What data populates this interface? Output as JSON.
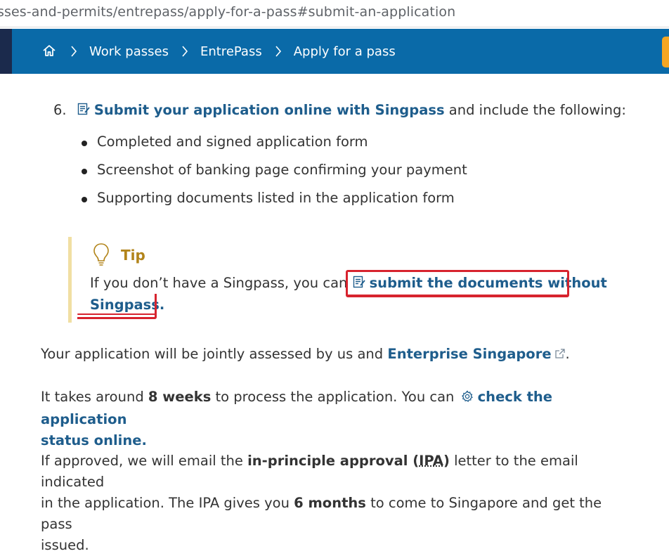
{
  "url": "sses-and-permits/entrepass/apply-for-a-pass#submit-an-application",
  "breadcrumb": {
    "items": [
      "Work passes",
      "EntrePass",
      "Apply for a pass"
    ]
  },
  "step": {
    "number": "6.",
    "link": "Submit your application online with Singpass",
    "rest": " and include the following:"
  },
  "bullets": [
    "Completed and signed application form",
    "Screenshot of banking page confirming your payment",
    "Supporting documents listed in the application form"
  ],
  "tip": {
    "label": "Tip",
    "text": "If you don’t have a Singpass, you can ",
    "link_part1": "submit the documents without",
    "link_part2": "Singpass."
  },
  "para1": {
    "text": "Your application will be jointly assessed by us and ",
    "link": "Enterprise Singapore",
    "end": "."
  },
  "para2": {
    "pre": "It takes around ",
    "bold": "8 weeks",
    "mid": " to process the application. You can ",
    "link1": "check the application",
    "link2": "status online."
  },
  "para3": {
    "pre": "If approved, we will email the ",
    "bold1": "in-principle approval (",
    "abbr": "IPA",
    "bold1_end": ")",
    "mid": " letter to the email indicated",
    "line2_pre": "in the application. The IPA gives you ",
    "bold2": "6 months",
    "line2_end": " to come to Singapore and get the pass",
    "line3": "issued."
  },
  "colors": {
    "nav_bg": "#0a6aa8",
    "link": "#1e5d8c",
    "tip_border": "#f1dfa3",
    "tip_label": "#b2841a",
    "annotation_red": "#d7232e"
  },
  "icons": [
    "home-icon",
    "chevron-right-icon",
    "document-icon",
    "lightbulb-icon",
    "external-link-icon",
    "gear-icon"
  ]
}
